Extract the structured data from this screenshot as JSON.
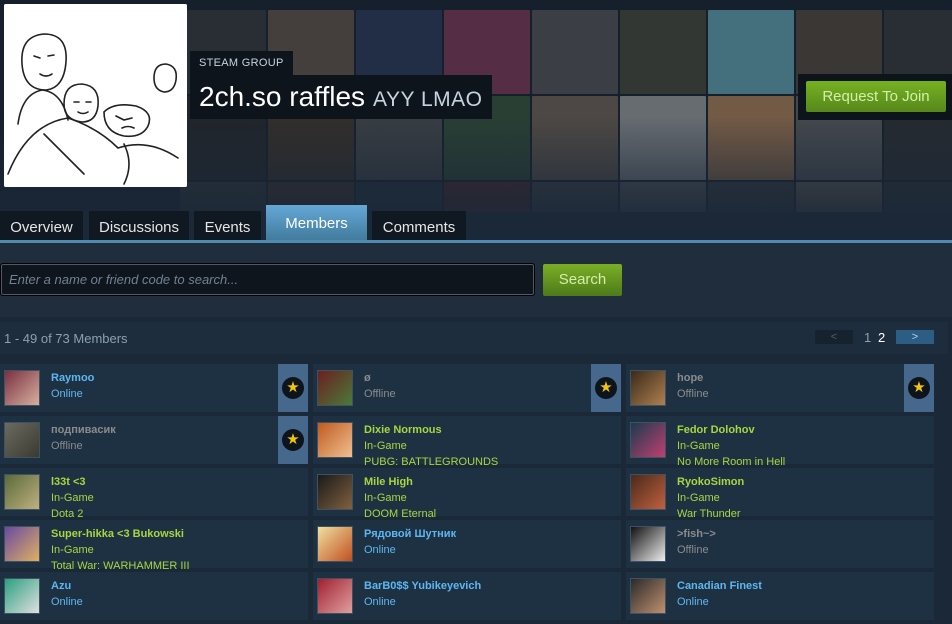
{
  "group": {
    "tag": "STEAM GROUP",
    "name": "2ch.so raffles",
    "abbreviation": "AYY LMAO",
    "join_label": "Request To Join"
  },
  "tabs": [
    {
      "label": "Overview"
    },
    {
      "label": "Discussions"
    },
    {
      "label": "Events"
    },
    {
      "label": "Members",
      "active": true
    },
    {
      "label": "Comments"
    }
  ],
  "search": {
    "placeholder": "Enter a name or friend code to search...",
    "button_label": "Search"
  },
  "member_count_text": "1 - 49 of 73 Members",
  "pagination": {
    "prev": "<",
    "page_1": "1",
    "page_2": "2",
    "current": 2,
    "next": ">"
  },
  "colors": {
    "online": "#5fb6ef",
    "offline": "#8b8b8b",
    "ingame": "#a6d73f",
    "join": "#75b022"
  },
  "members": [
    {
      "name": "Raymoo",
      "status": "Online",
      "game": "",
      "state": "online",
      "officer": true
    },
    {
      "name": "ø",
      "status": "Offline",
      "game": "",
      "state": "offline",
      "officer": true
    },
    {
      "name": "hope",
      "status": "Offline",
      "game": "",
      "state": "offline",
      "officer": true
    },
    {
      "name": "подпивасик",
      "status": "Offline",
      "game": "",
      "state": "offline",
      "officer": true
    },
    {
      "name": "Dixie Normous",
      "status": "In-Game",
      "game": "PUBG: BATTLEGROUNDS",
      "state": "ingame",
      "officer": false
    },
    {
      "name": "Fedor Dolohov",
      "status": "In-Game",
      "game": "No More Room in Hell",
      "state": "ingame",
      "officer": false
    },
    {
      "name": "l33t <3",
      "status": "In-Game",
      "game": "Dota 2",
      "state": "ingame",
      "officer": false
    },
    {
      "name": "Mile High",
      "status": "In-Game",
      "game": "DOOM Eternal",
      "state": "ingame",
      "officer": false
    },
    {
      "name": "RyokoSimon",
      "status": "In-Game",
      "game": "War Thunder",
      "state": "ingame",
      "officer": false
    },
    {
      "name": "Super-hikka <3 Bukowski",
      "status": "In-Game",
      "game": "Total War: WARHAMMER III",
      "state": "ingame",
      "officer": false
    },
    {
      "name": "Рядовой Шутник",
      "status": "Online",
      "game": "",
      "state": "online",
      "officer": false
    },
    {
      "name": ">fish~>",
      "status": "Offline",
      "game": "",
      "state": "offline",
      "officer": false
    },
    {
      "name": "Azu",
      "status": "Online",
      "game": "",
      "state": "online",
      "officer": false
    },
    {
      "name": "BarB0$$ Yubikeyevich",
      "status": "Online",
      "game": "",
      "state": "online",
      "officer": false
    },
    {
      "name": "Canadian Finest",
      "status": "Online",
      "game": "",
      "state": "online",
      "officer": false
    }
  ]
}
